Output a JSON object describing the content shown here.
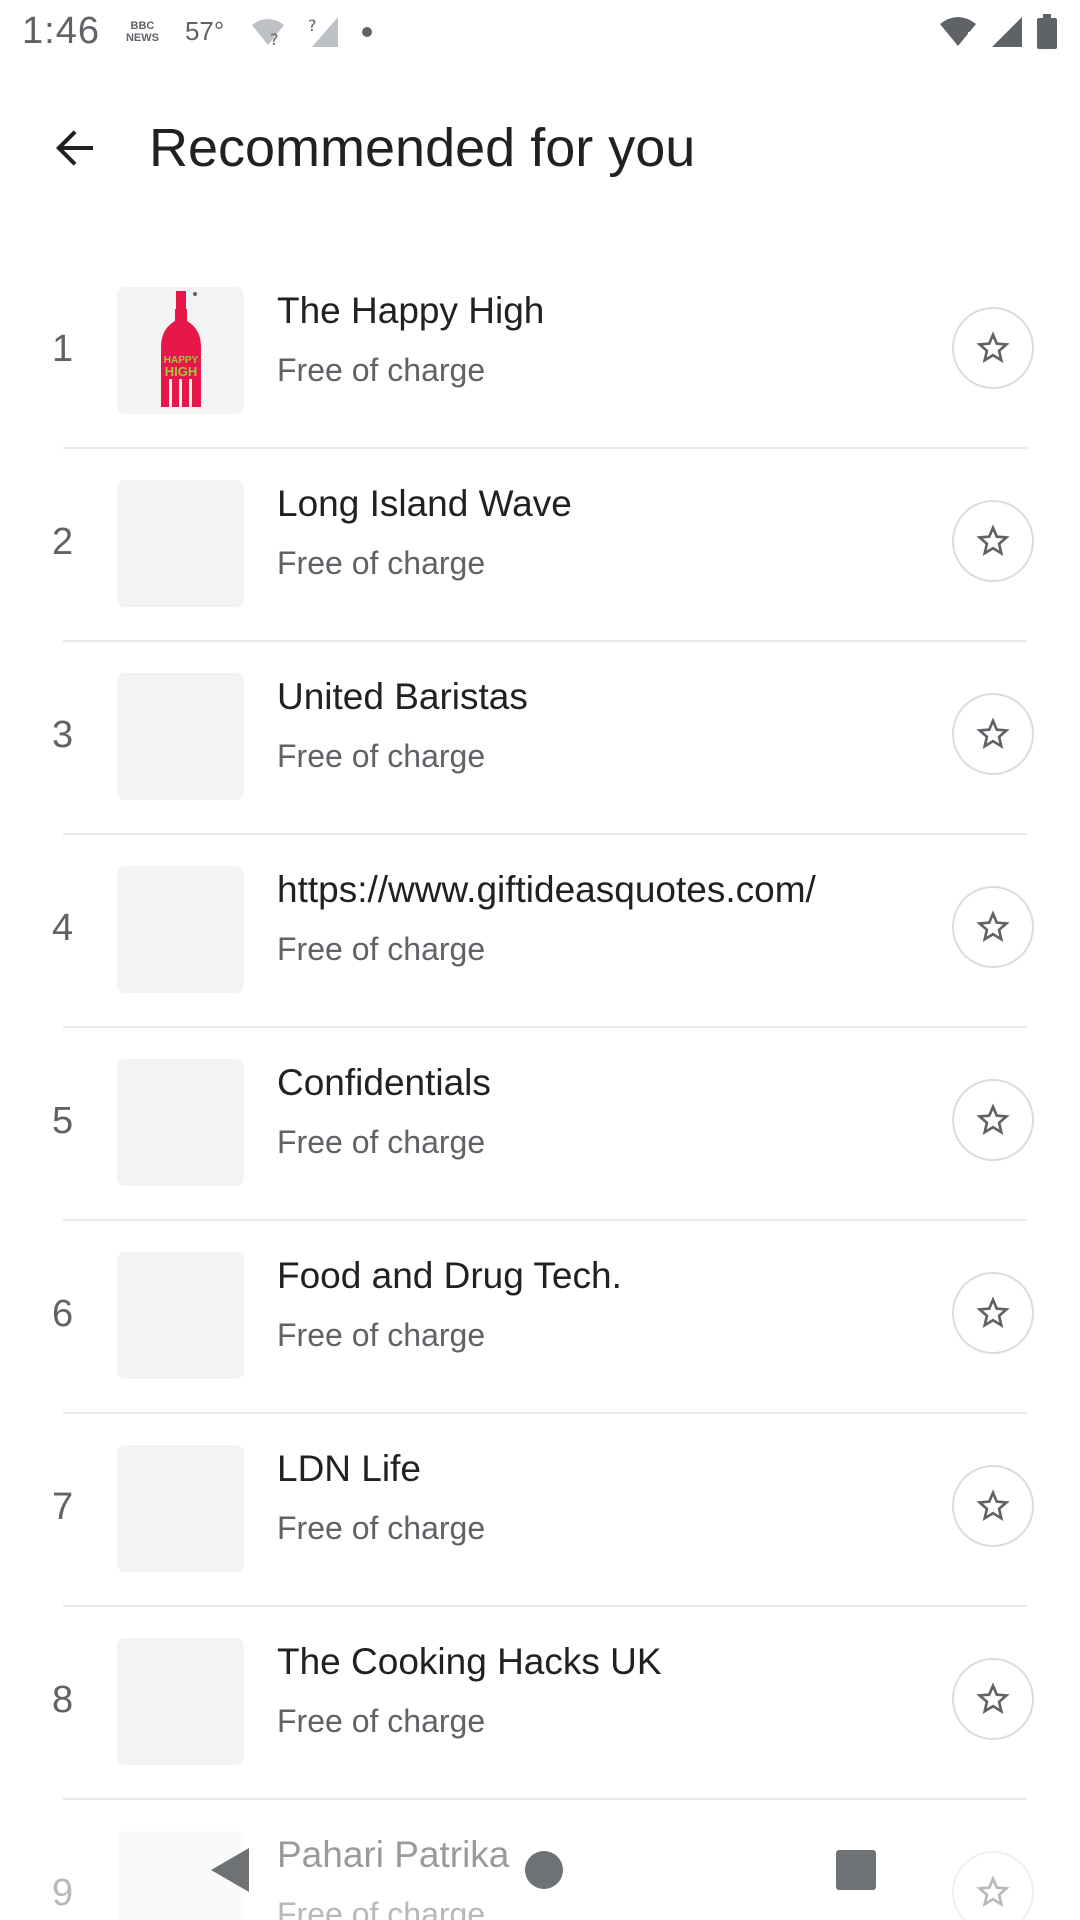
{
  "status_bar": {
    "time": "1:46",
    "news_line1": "BBC",
    "news_line2": "NEWS",
    "temperature": "57°"
  },
  "header": {
    "title": "Recommended for you"
  },
  "items": [
    {
      "rank": "1",
      "name": "The Happy High",
      "price": "Free of charge",
      "has_logo": true
    },
    {
      "rank": "2",
      "name": "Long Island Wave",
      "price": "Free of charge"
    },
    {
      "rank": "3",
      "name": "United Baristas",
      "price": "Free of charge"
    },
    {
      "rank": "4",
      "name": "https://www.giftideasquotes.com/",
      "price": "Free of charge"
    },
    {
      "rank": "5",
      "name": "Confidentials",
      "price": "Free of charge"
    },
    {
      "rank": "6",
      "name": "Food and Drug Tech.",
      "price": "Free of charge"
    },
    {
      "rank": "7",
      "name": "LDN Life",
      "price": "Free of charge"
    },
    {
      "rank": "8",
      "name": "The Cooking Hacks UK",
      "price": "Free of charge"
    },
    {
      "rank": "9",
      "name": "Pahari Patrika",
      "price": "Free of charge"
    }
  ],
  "logo": {
    "text_line1": "HAPPY",
    "text_line2": "HIGH",
    "bottle_color": "#e8174a",
    "text_color": "#9ccc3c"
  },
  "colors": {
    "text_primary": "#202124",
    "text_secondary": "#5f6368",
    "thumb_bg": "#f1f3f4",
    "divider": "#e8eaed"
  },
  "icons": {
    "back": "arrow-back-icon",
    "star": "star-outline-icon",
    "nav_back": "triangle-back-icon",
    "nav_home": "circle-home-icon",
    "nav_recents": "square-recents-icon"
  }
}
